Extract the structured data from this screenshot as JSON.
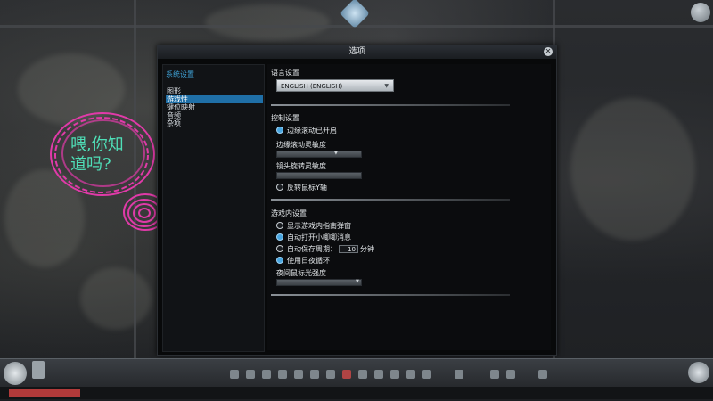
{
  "dialog": {
    "title": "选项",
    "close_glyph": "✕"
  },
  "sidebar": {
    "header": "系统设置",
    "items": [
      {
        "label": "图形",
        "active": false
      },
      {
        "label": "游戏性",
        "active": true
      },
      {
        "label": "键位映射",
        "active": false
      },
      {
        "label": "音频",
        "active": false
      },
      {
        "label": "杂项",
        "active": false
      }
    ]
  },
  "language": {
    "header": "语言设置",
    "selected": "ENGLISH (ENGLISH)"
  },
  "controls": {
    "header": "控制设置",
    "edge_scroll": {
      "label": "边缘滚动已开启",
      "checked": true
    },
    "edge_sensitivity_label": "边缘滚动灵敏度",
    "edge_sensitivity_level": 0.7,
    "camera_sensitivity_label": "镜头旋转灵敏度",
    "camera_sensitivity_level": 0.5,
    "invert_y": {
      "label": "反转鼠标Y轴",
      "checked": false
    }
  },
  "ingame": {
    "header": "游戏内设置",
    "tutorial_popup": {
      "label": "显示游戏内指南弹窗",
      "checked": false
    },
    "chirper_open": {
      "label": "自动打开小唧唧消息",
      "checked": true
    },
    "autosave": {
      "label": "自动保存周期：",
      "checked": false,
      "value": "10",
      "unit": "分钟"
    },
    "day_night": {
      "label": "使用日夜循环",
      "checked": true
    },
    "night_cursor_label": "夜间鼠标光强度",
    "night_cursor_level": 0.95
  },
  "bubble": {
    "line1": "喂,你知",
    "line2": "道吗?",
    "color": "#e03aa8"
  },
  "colors": {
    "accent": "#3fa3d8",
    "active_nav": "#1f6fa7",
    "radio_on": "#49a6e0"
  },
  "icons": {
    "close": "close-icon",
    "dropdown": "chevron-down-icon"
  }
}
